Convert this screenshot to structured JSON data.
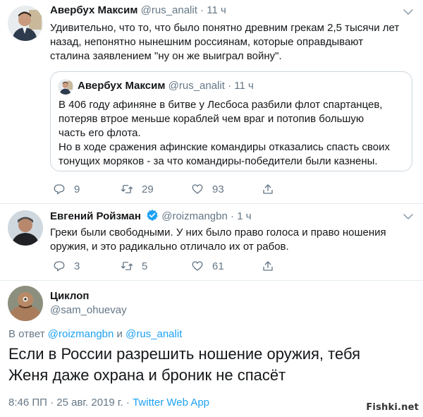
{
  "tweet1": {
    "name": "Авербух Максим",
    "handle": "@rus_analit",
    "time": "11 ч",
    "lines": [
      "Удивительно, что то, что было понятно древним грекам 2,5 тысячи лет",
      "назад, непонятно нынешним россиянам, которые оправдывают",
      "сталина заявлением \"ну он же выиграл войну\"."
    ],
    "quote": {
      "name": "Авербух Максим",
      "handle": "@rus_analit",
      "time": "11 ч",
      "lines": [
        "В 406 году афиняне в битве у Лесбоса разбили флот спартанцев,",
        "потеряв втрое меньше кораблей чем враг и потопив большую",
        "часть его флота.",
        "Но в ходе сражения афинские командиры отказались спасть своих",
        "тонущих моряков - за что командиры-победители были казнены."
      ]
    },
    "replies": "9",
    "retweets": "29",
    "likes": "93"
  },
  "tweet2": {
    "name": "Евгений Ройзман",
    "handle": "@roizmangbn",
    "time": "1 ч",
    "lines": [
      "Греки были свободными. У них было право голоса и право ношения",
      "оружия, и это радикально отличало их от рабов."
    ],
    "replies": "3",
    "retweets": "5",
    "likes": "61"
  },
  "tweet3": {
    "name": "Циклоп",
    "handle": "@sam_ohuevay",
    "reply_prefix": "В ответ",
    "reply_user1": "@roizmangbn",
    "reply_and": "и",
    "reply_user2": "@rus_analit",
    "lines": [
      "Если в России разрешить ношение оружия, тебя",
      "Женя даже охрана и броник не спасёт"
    ],
    "timestamp": "8:46 ПП · 25 авг. 2019 г. ·",
    "app": "Twitter Web App"
  },
  "watermark": "Fishki.net",
  "colors": {
    "accent": "#1da1f2",
    "muted": "#657786",
    "text": "#14171a",
    "border": "#ccd6dd"
  },
  "icons": [
    "chevron-down-icon",
    "reply-icon",
    "retweet-icon",
    "like-icon",
    "share-icon",
    "verified-icon"
  ]
}
